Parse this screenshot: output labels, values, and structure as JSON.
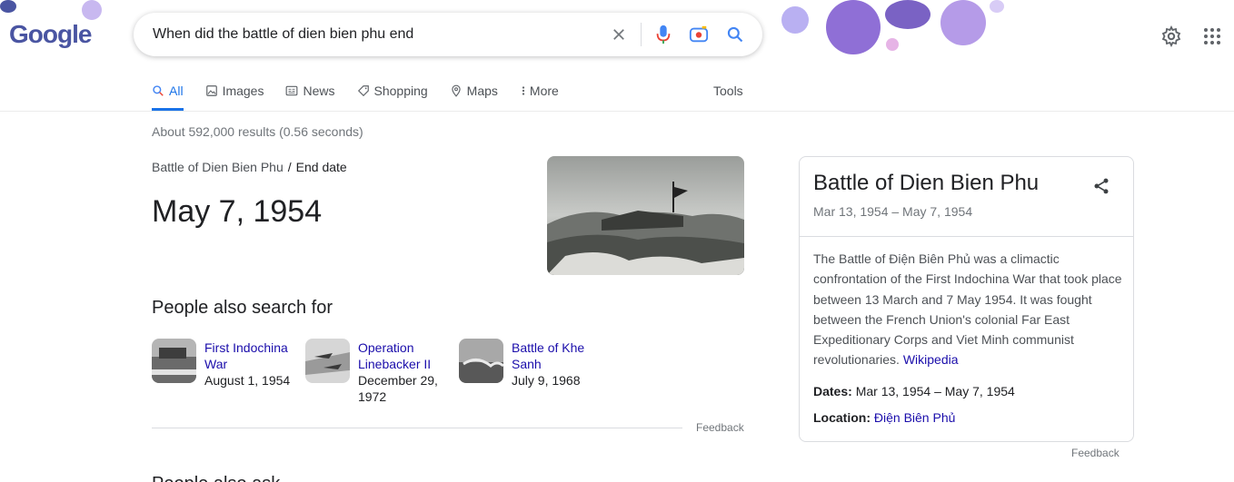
{
  "header": {
    "logo_text": "Google",
    "search_query": "When did the battle of dien bien phu end"
  },
  "tabs": [
    {
      "label": "All",
      "icon": "search-icon"
    },
    {
      "label": "Images",
      "icon": "image-icon"
    },
    {
      "label": "News",
      "icon": "news-icon"
    },
    {
      "label": "Shopping",
      "icon": "tag-icon"
    },
    {
      "label": "Maps",
      "icon": "map-pin-icon"
    },
    {
      "label": "More",
      "icon": "more-vertical-icon"
    }
  ],
  "tools_label": "Tools",
  "result_stats": "About 592,000 results (0.56 seconds)",
  "answer": {
    "breadcrumb_parent": "Battle of Dien Bien Phu",
    "breadcrumb_sep": "/",
    "breadcrumb_current": "End date",
    "value": "May 7, 1954"
  },
  "people_also_search": {
    "title": "People also search for",
    "items": [
      {
        "name": "First Indochina War",
        "date": "August 1, 1954"
      },
      {
        "name": "Operation Linebacker II",
        "date": "December 29, 1972"
      },
      {
        "name": "Battle of Khe Sanh",
        "date": "July 9, 1968"
      }
    ],
    "feedback": "Feedback"
  },
  "knowledge_panel": {
    "title": "Battle of Dien Bien Phu",
    "subtitle": "Mar 13, 1954 – May 7, 1954",
    "description": "The Battle of Điện Biên Phủ was a climactic confrontation of the First Indochina War that took place between 13 March and 7 May 1954. It was fought between the French Union's colonial Far East Expeditionary Corps and Viet Minh communist revolutionaries.",
    "source_link": "Wikipedia",
    "dates_label": "Dates:",
    "dates_value": "Mar 13, 1954 – May 7, 1954",
    "location_label": "Location:",
    "location_value": "Điện Biên Phủ",
    "feedback": "Feedback"
  },
  "next_section_partial": "People also ask",
  "colors": {
    "accent": "#1a73e8",
    "link": "#1a0dab",
    "muted": "#70757a"
  }
}
